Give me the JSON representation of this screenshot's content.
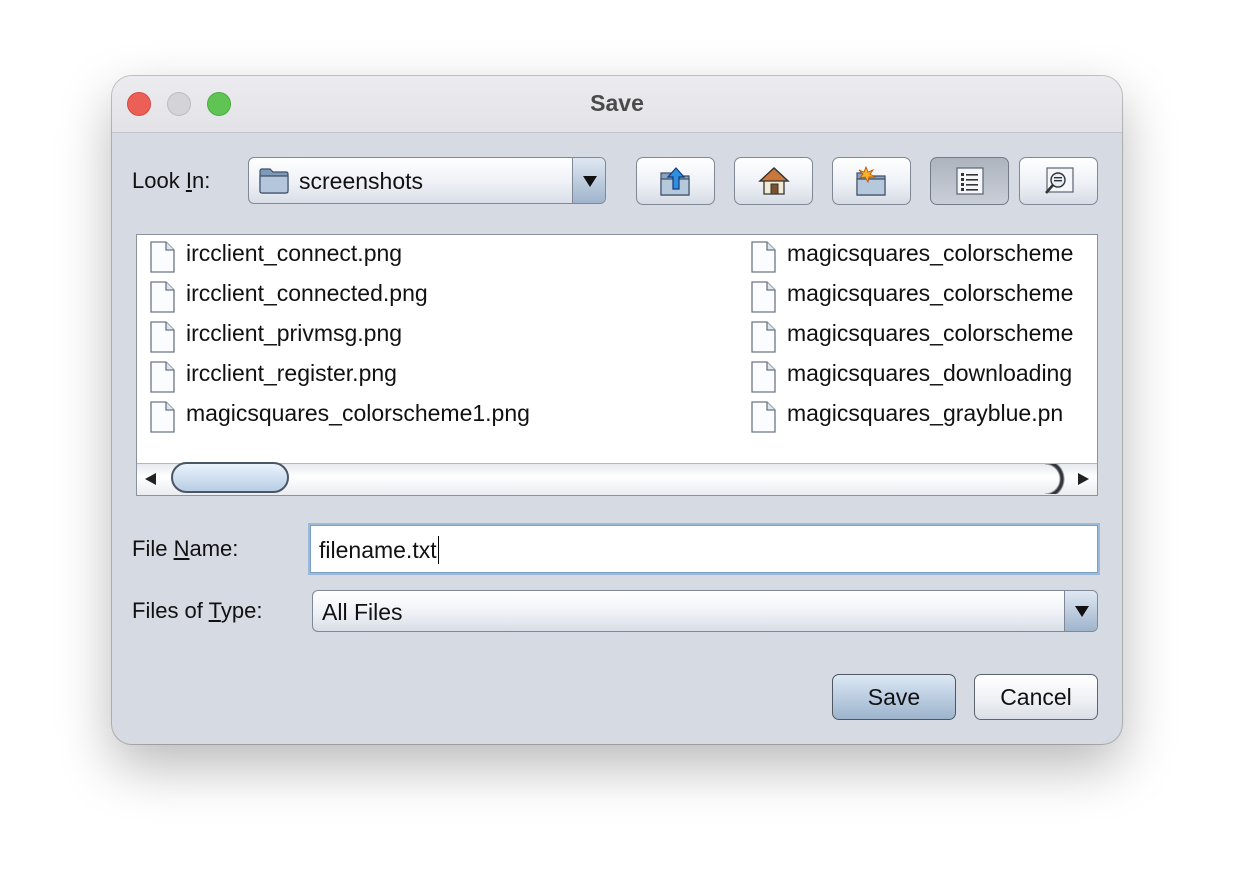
{
  "window": {
    "title": "Save"
  },
  "look_in": {
    "label_pre": "Look ",
    "label_mn": "I",
    "label_post": "n:",
    "value": "screenshots",
    "folder_icon": "folder-icon"
  },
  "toolbar": {
    "buttons": [
      {
        "name": "up-one-level",
        "icon": "folder-up-icon",
        "pressed": false
      },
      {
        "name": "home",
        "icon": "home-icon",
        "pressed": false
      },
      {
        "name": "new-folder",
        "icon": "new-folder-icon",
        "pressed": false
      },
      {
        "name": "list-view",
        "icon": "list-view-icon",
        "pressed": true
      },
      {
        "name": "details-view",
        "icon": "details-view-icon",
        "pressed": false
      }
    ]
  },
  "files": {
    "col1": [
      "ircclient_connect.png",
      "ircclient_connected.png",
      "ircclient_privmsg.png",
      "ircclient_register.png",
      "magicsquares_colorscheme1.png"
    ],
    "col2": [
      "magicsquares_colorscheme",
      "magicsquares_colorscheme",
      "magicsquares_colorscheme",
      "magicsquares_downloading",
      "magicsquares_grayblue.pn"
    ],
    "file_icon": "document-icon"
  },
  "file_name": {
    "label_pre": "File ",
    "label_mn": "N",
    "label_post": "ame:",
    "value": "filename.txt"
  },
  "file_type": {
    "label_pre": "Files of ",
    "label_mn": "T",
    "label_post": "ype:",
    "value": "All Files"
  },
  "buttons": {
    "save": "Save",
    "cancel": "Cancel"
  },
  "colors": {
    "close": "#ec5f57",
    "minimize": "#d4d4d8",
    "maximize": "#60c455",
    "dialog_bg": "#d6dae2",
    "focus_ring": "#9bbad9"
  }
}
